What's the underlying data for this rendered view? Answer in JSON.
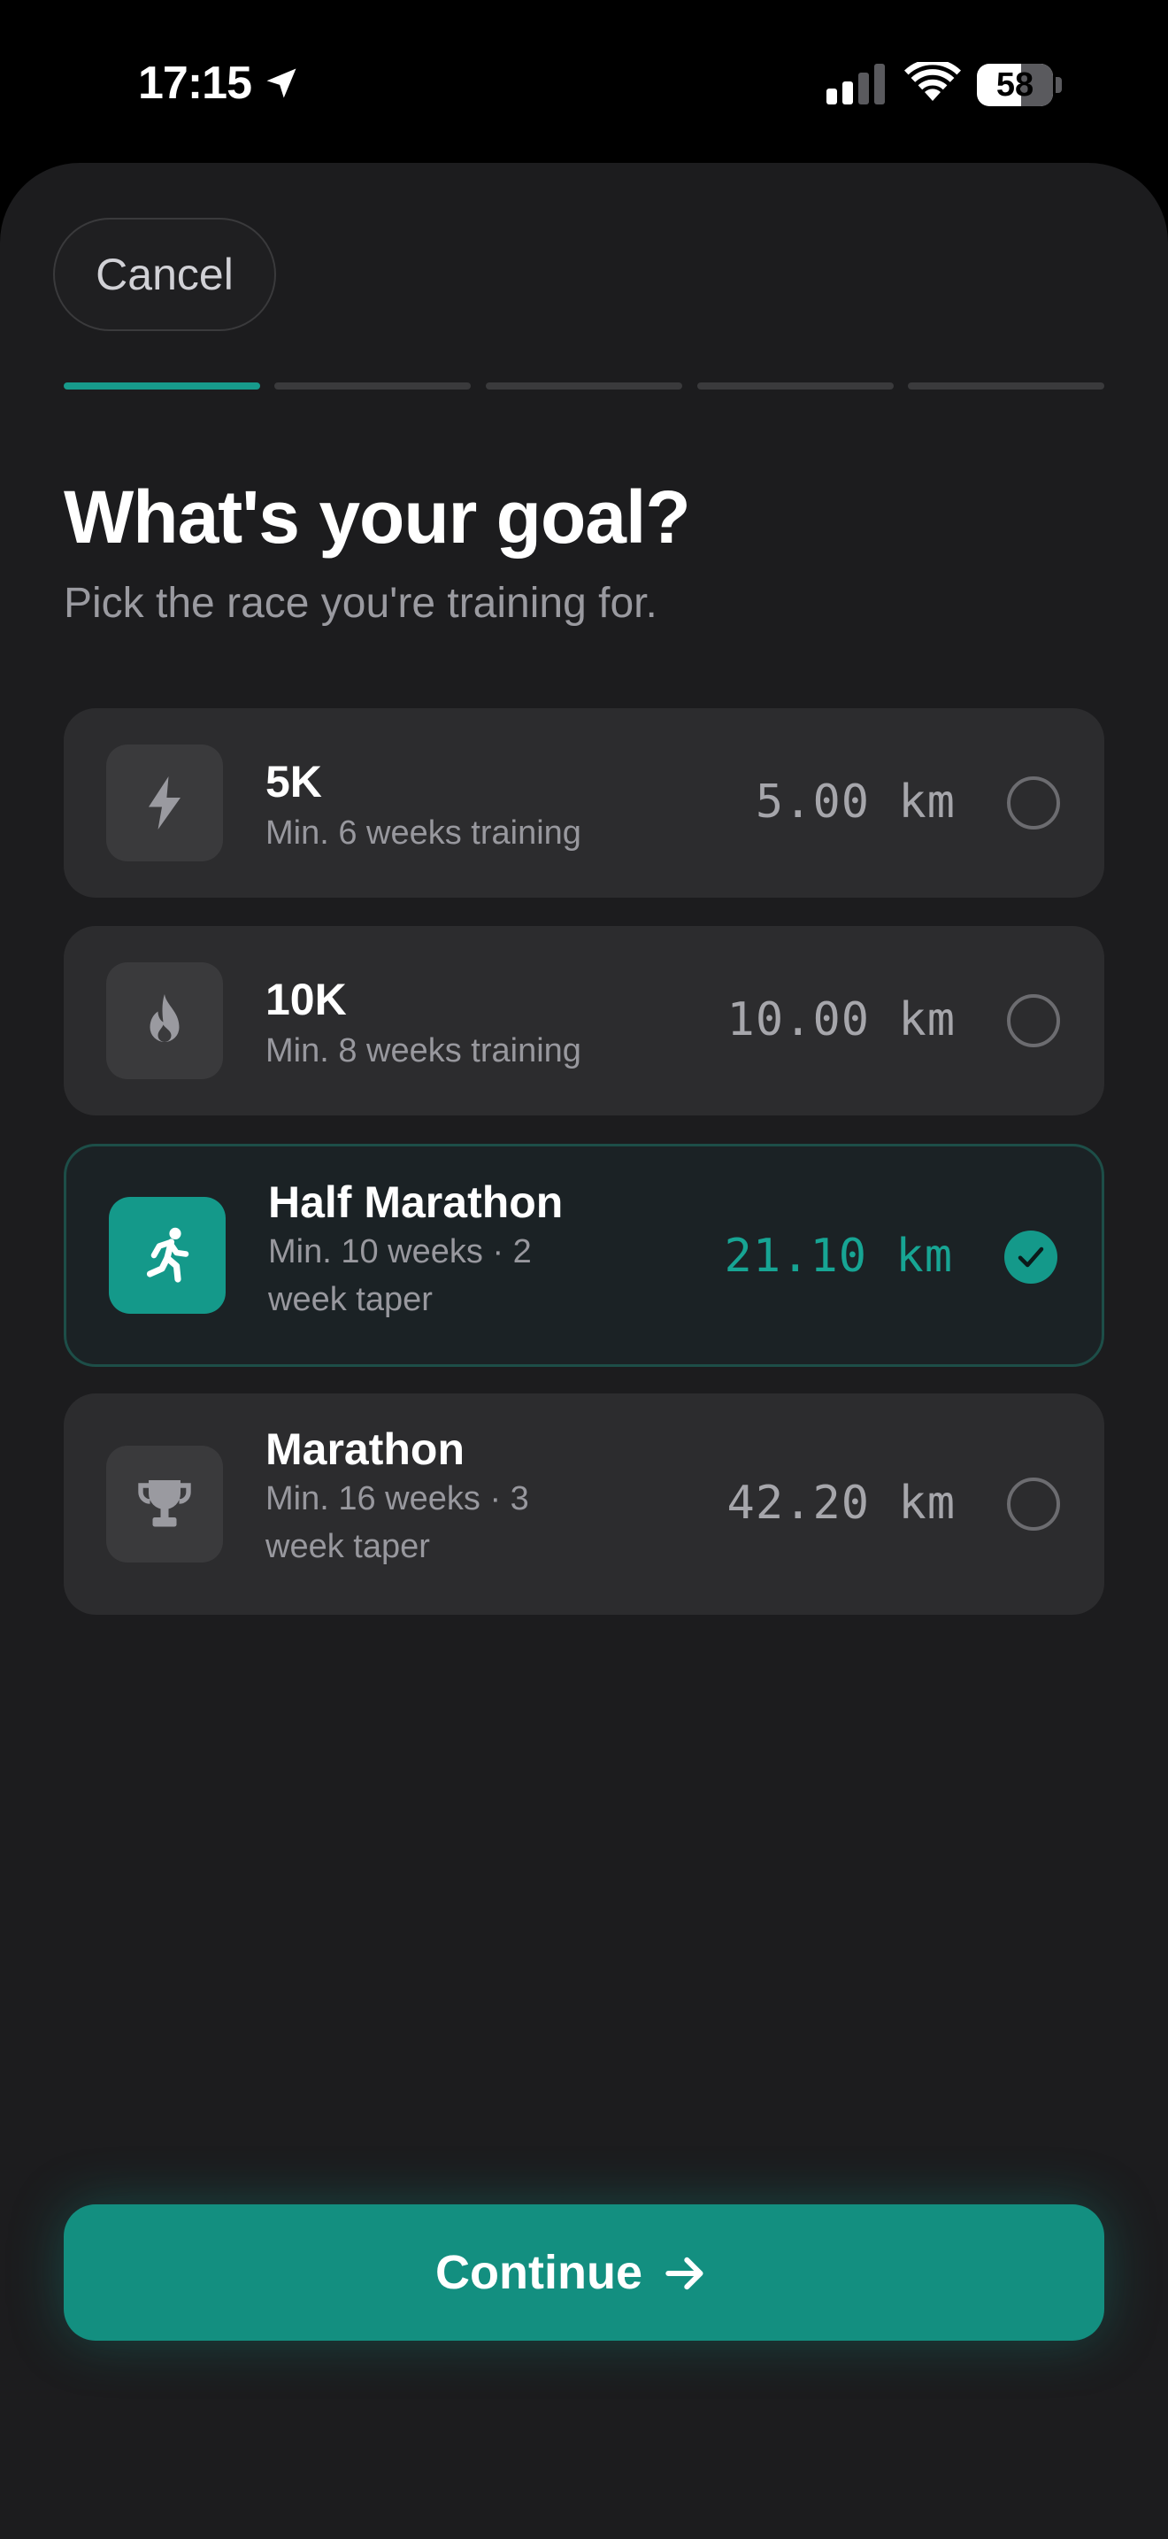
{
  "status_bar": {
    "time": "17:15",
    "battery_level": "58",
    "battery_fraction": 0.58
  },
  "header": {
    "cancel_label": "Cancel",
    "progress_total_steps": 5,
    "progress_current_step": 1
  },
  "page": {
    "title": "What's your goal?",
    "subtitle": "Pick the race you're training for."
  },
  "options": [
    {
      "name": "5K",
      "description": "Min. 6 weeks training",
      "distance": "5.00 km",
      "icon": "lightning-icon",
      "selected": false
    },
    {
      "name": "10K",
      "description": "Min. 8 weeks training",
      "distance": "10.00 km",
      "icon": "flame-icon",
      "selected": false
    },
    {
      "name": "Half Marathon",
      "description": "Min. 10 weeks · 2 week taper",
      "distance": "21.10 km",
      "icon": "runner-icon",
      "selected": true
    },
    {
      "name": "Marathon",
      "description": "Min. 16 weeks · 3 week taper",
      "distance": "42.20 km",
      "icon": "trophy-icon",
      "selected": false
    }
  ],
  "footer": {
    "continue_label": "Continue"
  },
  "colors": {
    "accent": "#14998a",
    "background": "#1c1c1e",
    "card": "#2c2c2e"
  }
}
